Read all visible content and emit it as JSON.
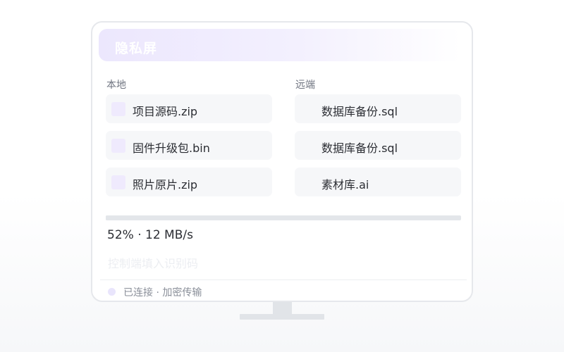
{
  "app": {
    "title": "隐私屏"
  },
  "local": {
    "label": "本地",
    "files": [
      {
        "name": "项目源码.zip"
      },
      {
        "name": "固件升级包.bin"
      },
      {
        "name": "照片原片.zip"
      }
    ]
  },
  "remote": {
    "label": "远端",
    "files": [
      {
        "name": "数据库备份.sql"
      },
      {
        "name": "数据库备份.sql"
      },
      {
        "name": "素材库.ai"
      }
    ]
  },
  "transfer": {
    "progress": 0.52,
    "status_text": "52% · 12 MB/s"
  },
  "code_input": {
    "value": "",
    "placeholder": "控制端填入识别码"
  },
  "connection": {
    "status_text": "已连接 · 加密传输"
  },
  "colors": {
    "accent_light": "#efeafd",
    "progress_track": "#e3e6ea",
    "text": "#2b2d33",
    "muted": "#6f7480"
  },
  "icons": {
    "file": "file-icon",
    "status": "status-dot-icon"
  }
}
